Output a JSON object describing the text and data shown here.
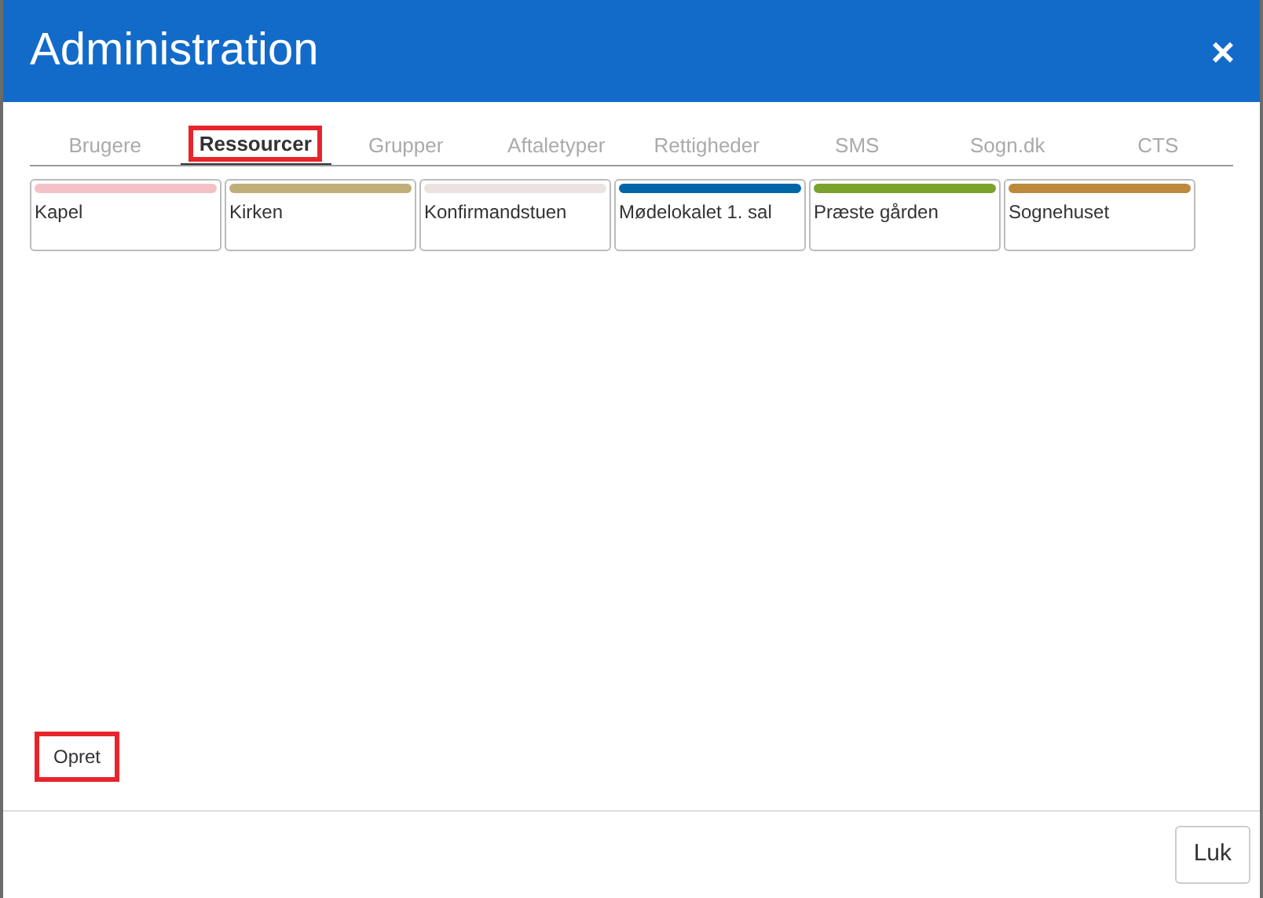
{
  "window": {
    "title": "Administration",
    "close": "×"
  },
  "tabs": [
    {
      "label": "Brugere",
      "selected": false,
      "highlighted": false
    },
    {
      "label": "Ressourcer",
      "selected": true,
      "highlighted": true
    },
    {
      "label": "Grupper",
      "selected": false,
      "highlighted": false
    },
    {
      "label": "Aftaletyper",
      "selected": false,
      "highlighted": false
    },
    {
      "label": "Rettigheder",
      "selected": false,
      "highlighted": false
    },
    {
      "label": "SMS",
      "selected": false,
      "highlighted": false
    },
    {
      "label": "Sogn.dk",
      "selected": false,
      "highlighted": false
    },
    {
      "label": "CTS",
      "selected": false,
      "highlighted": false
    }
  ],
  "resources": [
    {
      "name": "Kapel",
      "color": "#f4c2c6"
    },
    {
      "name": "Kirken",
      "color": "#bfae78"
    },
    {
      "name": "Konfirmandstuen",
      "color": "#ebe3e1"
    },
    {
      "name": "Mødelokalet 1. sal",
      "color": "#0066a6"
    },
    {
      "name": "Præste gården",
      "color": "#7ba22d"
    },
    {
      "name": "Sognehuset",
      "color": "#bd8a3c"
    }
  ],
  "create_button": {
    "label": "Opret",
    "highlighted": true
  },
  "footer": {
    "close_button": "Luk"
  }
}
